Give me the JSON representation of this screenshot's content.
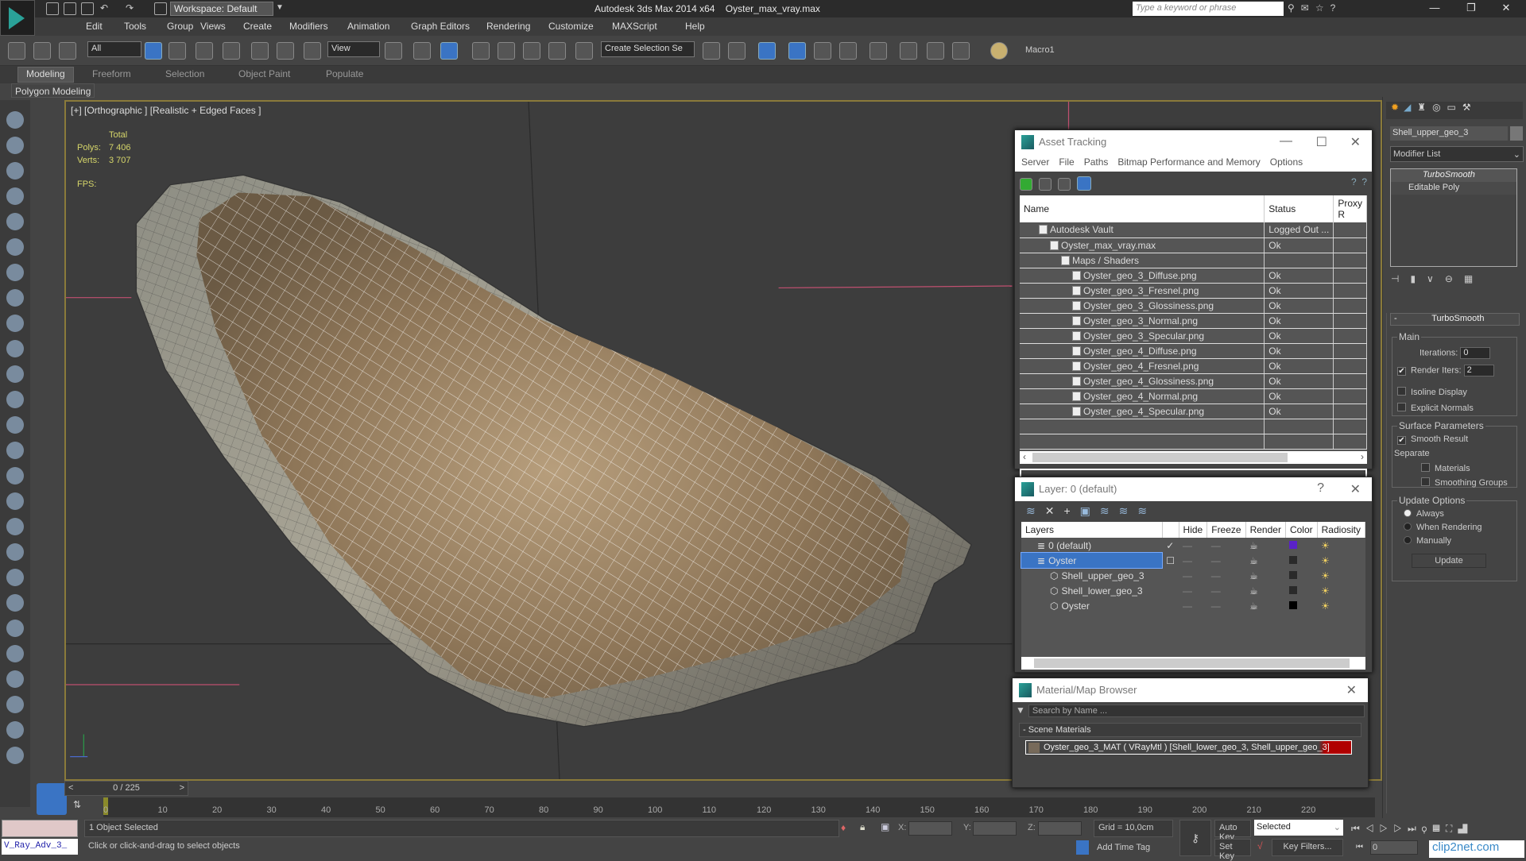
{
  "titlebar": {
    "workspace": "Workspace: Default",
    "app_title": "Autodesk 3ds Max  2014 x64",
    "file_name": "Oyster_max_vray.max",
    "search_placeholder": "Type a keyword or phrase",
    "minimize": "—",
    "restore": "❐",
    "close": "✕"
  },
  "menu": [
    "Edit",
    "Tools",
    "Group",
    "Views",
    "Create",
    "Modifiers",
    "Animation",
    "Graph Editors",
    "Rendering",
    "Customize",
    "MAXScript",
    "Help"
  ],
  "toolbar": {
    "filter": "All",
    "ref_coord": "View",
    "selection_set": "Create Selection Se",
    "macro": "Macro1"
  },
  "ribbon": {
    "tabs": [
      "Modeling",
      "Freeform",
      "Selection",
      "Object Paint",
      "Populate"
    ],
    "active": "Modeling",
    "panel": "Polygon Modeling"
  },
  "viewport": {
    "label": "[+] [Orthographic ] [Realistic + Edged Faces ]",
    "stats": {
      "total": "Total",
      "polys_label": "Polys:",
      "polys": "7 406",
      "verts_label": "Verts:",
      "verts": "3 707",
      "fps_label": "FPS:"
    }
  },
  "asset_tracking": {
    "title": "Asset Tracking",
    "menu": [
      "Server",
      "File",
      "Paths",
      "Bitmap Performance and Memory",
      "Options"
    ],
    "columns": [
      "Name",
      "Status",
      "Proxy R"
    ],
    "rows": [
      {
        "name": "Autodesk Vault",
        "status": "Logged Out ...",
        "level": 1
      },
      {
        "name": "Oyster_max_vray.max",
        "status": "Ok",
        "level": 2
      },
      {
        "name": "Maps / Shaders",
        "status": "",
        "level": 3
      },
      {
        "name": "Oyster_geo_3_Diffuse.png",
        "status": "Ok",
        "level": 4
      },
      {
        "name": "Oyster_geo_3_Fresnel.png",
        "status": "Ok",
        "level": 4
      },
      {
        "name": "Oyster_geo_3_Glossiness.png",
        "status": "Ok",
        "level": 4
      },
      {
        "name": "Oyster_geo_3_Normal.png",
        "status": "Ok",
        "level": 4
      },
      {
        "name": "Oyster_geo_3_Specular.png",
        "status": "Ok",
        "level": 4
      },
      {
        "name": "Oyster_geo_4_Diffuse.png",
        "status": "Ok",
        "level": 4
      },
      {
        "name": "Oyster_geo_4_Fresnel.png",
        "status": "Ok",
        "level": 4
      },
      {
        "name": "Oyster_geo_4_Glossiness.png",
        "status": "Ok",
        "level": 4
      },
      {
        "name": "Oyster_geo_4_Normal.png",
        "status": "Ok",
        "level": 4
      },
      {
        "name": "Oyster_geo_4_Specular.png",
        "status": "Ok",
        "level": 4
      }
    ]
  },
  "layer_manager": {
    "title": "Layer: 0 (default)",
    "help": "?",
    "columns": [
      "Layers",
      "",
      "Hide",
      "Freeze",
      "Render",
      "Color",
      "Radiosity"
    ],
    "rows": [
      {
        "name": "0 (default)",
        "color": "#5a22c8",
        "level": 0,
        "current": true
      },
      {
        "name": "Oyster",
        "color": "#2a2a2a",
        "level": 0,
        "selected": true
      },
      {
        "name": "Shell_upper_geo_3",
        "color": "#2a2a2a",
        "level": 1
      },
      {
        "name": "Shell_lower_geo_3",
        "color": "#2a2a2a",
        "level": 1
      },
      {
        "name": "Oyster",
        "color": "#000000",
        "level": 1
      }
    ]
  },
  "material_browser": {
    "title": "Material/Map Browser",
    "search_placeholder": "Search by Name ...",
    "group": "- Scene Materials",
    "item": "Oyster_geo_3_MAT  ( VRayMtl )  [Shell_lower_geo_3, Shell_upper_geo_3]"
  },
  "command_panel": {
    "object_name": "Shell_upper_geo_3",
    "modifier_list": "Modifier List",
    "stack": [
      "TurboSmooth",
      "Editable Poly"
    ],
    "rollout": "TurboSmooth",
    "main": "Main",
    "iterations_label": "Iterations:",
    "iterations": "0",
    "render_iters_label": "Render Iters:",
    "render_iters": "2",
    "isoline": "Isoline Display",
    "explicit_normals": "Explicit Normals",
    "surface": "Surface Parameters",
    "smooth_result": "Smooth Result",
    "separate": "Separate",
    "materials": "Materials",
    "smoothing_groups": "Smoothing Groups",
    "update_options": "Update Options",
    "always": "Always",
    "when_rendering": "When Rendering",
    "manually": "Manually",
    "update": "Update"
  },
  "timeline": {
    "frame": "0 / 225",
    "ticks": [
      "0",
      "10",
      "20",
      "30",
      "40",
      "50",
      "60",
      "70",
      "80",
      "90",
      "100",
      "110",
      "120",
      "130",
      "140",
      "150",
      "160",
      "170",
      "180",
      "190",
      "200",
      "210",
      "220"
    ]
  },
  "status": {
    "maxscript": "V_Ray_Adv_3_",
    "selected": "1 Object Selected",
    "prompt": "Click or click-and-drag to select objects",
    "x": "X:",
    "y": "Y:",
    "z": "Z:",
    "grid": "Grid = 10,0cm",
    "add_time_tag": "Add Time Tag",
    "auto_key": "Auto Key",
    "set_key": "Set Key",
    "key_mode": "Selected",
    "key_filters": "Key Filters...",
    "current_frame": "0",
    "watermark": "clip2net.com"
  }
}
